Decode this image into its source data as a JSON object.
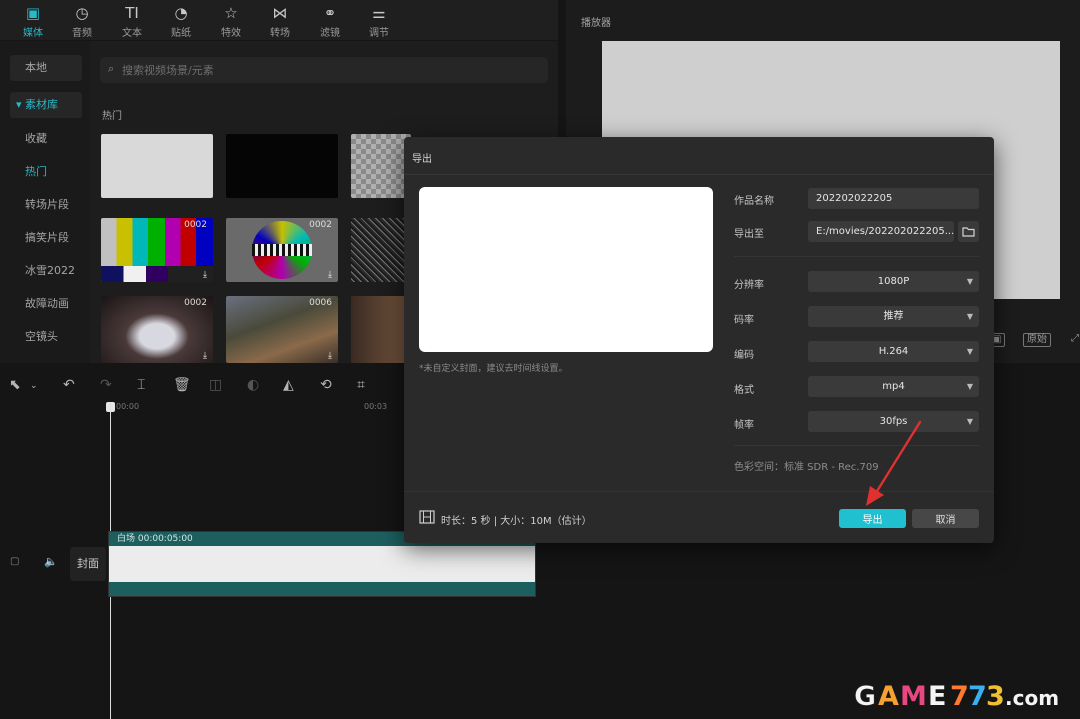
{
  "toolbar": {
    "tools": [
      {
        "label": "媒体",
        "icon": "media-icon",
        "glyph": "▣"
      },
      {
        "label": "音频",
        "icon": "audio-icon",
        "glyph": "◷"
      },
      {
        "label": "文本",
        "icon": "text-icon",
        "glyph": "TI"
      },
      {
        "label": "贴纸",
        "icon": "sticker-icon",
        "glyph": "◔"
      },
      {
        "label": "特效",
        "icon": "effects-icon",
        "glyph": "☆"
      },
      {
        "label": "转场",
        "icon": "transition-icon",
        "glyph": "⋈"
      },
      {
        "label": "滤镜",
        "icon": "filter-icon",
        "glyph": "⚭"
      },
      {
        "label": "调节",
        "icon": "adjust-icon",
        "glyph": "⚌"
      }
    ]
  },
  "media": {
    "nav": [
      "本地",
      "▾ 素材库",
      "收藏",
      "热门",
      "转场片段",
      "搞笑片段",
      "冰雪2022",
      "故障动画",
      "空镜头"
    ],
    "search_placeholder": "搜索视频场景/元素",
    "section_title": "热门",
    "durations": [
      "0002",
      "0002",
      "0002",
      "0006"
    ]
  },
  "player": {
    "title": "播放器",
    "ratio_label": "原始"
  },
  "timeline": {
    "times": [
      "00:00",
      "00:03"
    ],
    "cover_label": "封面",
    "clip_label": "白场   00:00:05:00"
  },
  "dialog": {
    "title": "导出",
    "cover_hint": "*未自定义封面，建议去时间线设置。",
    "fields": {
      "name_label": "作品名称",
      "name_value": "202202022205",
      "path_label": "导出至",
      "path_value": "E:/movies/202202022205...",
      "resolution_label": "分辨率",
      "resolution_value": "1080P",
      "bitrate_label": "码率",
      "bitrate_value": "推荐",
      "codec_label": "编码",
      "codec_value": "H.264",
      "format_label": "格式",
      "format_value": "mp4",
      "fps_label": "帧率",
      "fps_value": "30fps"
    },
    "color_space": "色彩空间：标准 SDR - Rec.709",
    "duration_info": "时长：5 秒 | 大小：10M（估计）",
    "export_label": "导出",
    "cancel_label": "取消"
  },
  "colors": {
    "accent": "#20c0d0",
    "arrow": "#e03030"
  },
  "watermark": "GAME773.com"
}
